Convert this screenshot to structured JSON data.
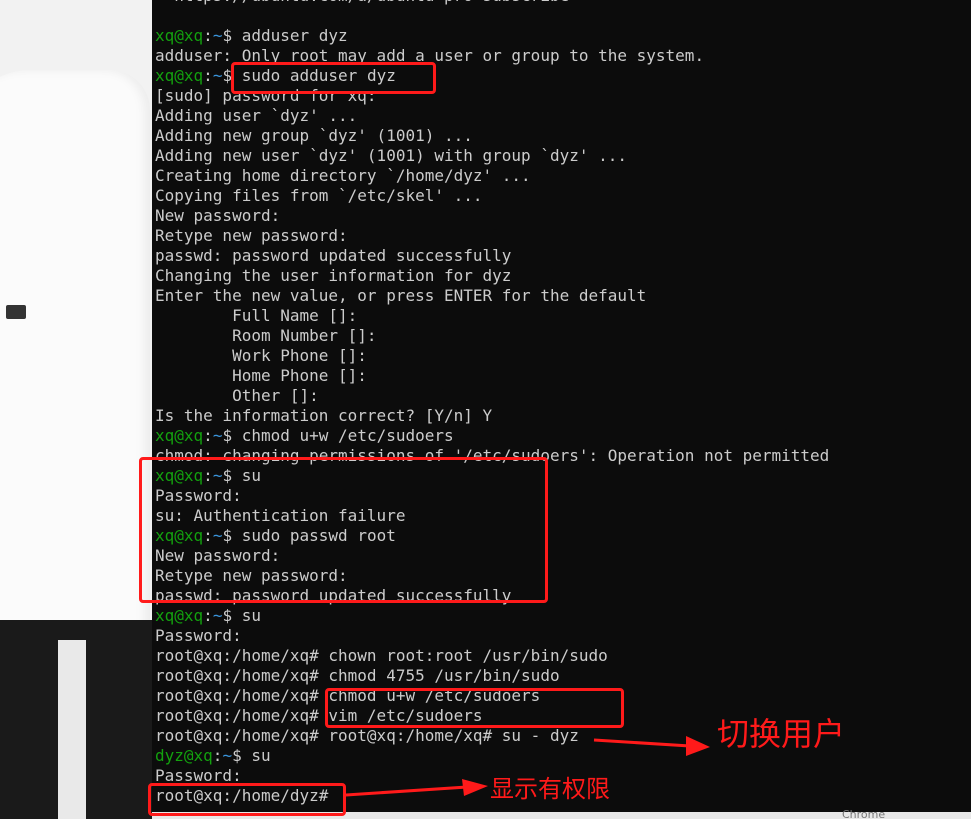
{
  "terminal": {
    "lines": [
      {
        "segments": [
          {
            "t": "  https://ubuntu.com/a/ubuntu-pro-subscribe",
            "c": "out"
          }
        ]
      },
      {
        "segments": []
      },
      {
        "segments": [
          {
            "t": "xq@xq",
            "c": "user"
          },
          {
            "t": ":",
            "c": "sep"
          },
          {
            "t": "~",
            "c": "path"
          },
          {
            "t": "$ adduser dyz",
            "c": "out"
          }
        ]
      },
      {
        "segments": [
          {
            "t": "adduser: Only root may add a user or group to the system.",
            "c": "out"
          }
        ]
      },
      {
        "segments": [
          {
            "t": "xq@xq",
            "c": "user"
          },
          {
            "t": ":",
            "c": "sep"
          },
          {
            "t": "~",
            "c": "path"
          },
          {
            "t": "$ sudo adduser dyz",
            "c": "out"
          }
        ]
      },
      {
        "segments": [
          {
            "t": "[sudo] password for xq:",
            "c": "out"
          }
        ]
      },
      {
        "segments": [
          {
            "t": "Adding user `dyz' ...",
            "c": "out"
          }
        ]
      },
      {
        "segments": [
          {
            "t": "Adding new group `dyz' (1001) ...",
            "c": "out"
          }
        ]
      },
      {
        "segments": [
          {
            "t": "Adding new user `dyz' (1001) with group `dyz' ...",
            "c": "out"
          }
        ]
      },
      {
        "segments": [
          {
            "t": "Creating home directory `/home/dyz' ...",
            "c": "out"
          }
        ]
      },
      {
        "segments": [
          {
            "t": "Copying files from `/etc/skel' ...",
            "c": "out"
          }
        ]
      },
      {
        "segments": [
          {
            "t": "New password:",
            "c": "out"
          }
        ]
      },
      {
        "segments": [
          {
            "t": "Retype new password:",
            "c": "out"
          }
        ]
      },
      {
        "segments": [
          {
            "t": "passwd: password updated successfully",
            "c": "out"
          }
        ]
      },
      {
        "segments": [
          {
            "t": "Changing the user information for dyz",
            "c": "out"
          }
        ]
      },
      {
        "segments": [
          {
            "t": "Enter the new value, or press ENTER for the default",
            "c": "out"
          }
        ]
      },
      {
        "segments": [
          {
            "t": "        Full Name []:",
            "c": "out"
          }
        ]
      },
      {
        "segments": [
          {
            "t": "        Room Number []:",
            "c": "out"
          }
        ]
      },
      {
        "segments": [
          {
            "t": "        Work Phone []:",
            "c": "out"
          }
        ]
      },
      {
        "segments": [
          {
            "t": "        Home Phone []:",
            "c": "out"
          }
        ]
      },
      {
        "segments": [
          {
            "t": "        Other []:",
            "c": "out"
          }
        ]
      },
      {
        "segments": [
          {
            "t": "Is the information correct? [Y/n] Y",
            "c": "out"
          }
        ]
      },
      {
        "segments": [
          {
            "t": "xq@xq",
            "c": "user"
          },
          {
            "t": ":",
            "c": "sep"
          },
          {
            "t": "~",
            "c": "path"
          },
          {
            "t": "$ chmod u+w /etc/sudoers",
            "c": "out"
          }
        ]
      },
      {
        "segments": [
          {
            "t": "chmod: changing permissions of '/etc/sudoers': Operation not permitted",
            "c": "out"
          }
        ]
      },
      {
        "segments": [
          {
            "t": "xq@xq",
            "c": "user"
          },
          {
            "t": ":",
            "c": "sep"
          },
          {
            "t": "~",
            "c": "path"
          },
          {
            "t": "$ su",
            "c": "out"
          }
        ]
      },
      {
        "segments": [
          {
            "t": "Password:",
            "c": "out"
          }
        ]
      },
      {
        "segments": [
          {
            "t": "su: Authentication failure",
            "c": "out"
          }
        ]
      },
      {
        "segments": [
          {
            "t": "xq@xq",
            "c": "user"
          },
          {
            "t": ":",
            "c": "sep"
          },
          {
            "t": "~",
            "c": "path"
          },
          {
            "t": "$ sudo passwd root",
            "c": "out"
          }
        ]
      },
      {
        "segments": [
          {
            "t": "New password:",
            "c": "out"
          }
        ]
      },
      {
        "segments": [
          {
            "t": "Retype new password:",
            "c": "out"
          }
        ]
      },
      {
        "segments": [
          {
            "t": "passwd: password updated successfully",
            "c": "out"
          }
        ]
      },
      {
        "segments": [
          {
            "t": "xq@xq",
            "c": "user"
          },
          {
            "t": ":",
            "c": "sep"
          },
          {
            "t": "~",
            "c": "path"
          },
          {
            "t": "$ su",
            "c": "out"
          }
        ]
      },
      {
        "segments": [
          {
            "t": "Password:",
            "c": "out"
          }
        ]
      },
      {
        "segments": [
          {
            "t": "root@xq:/home/xq# chown root:root /usr/bin/sudo",
            "c": "out"
          }
        ]
      },
      {
        "segments": [
          {
            "t": "root@xq:/home/xq# chmod 4755 /usr/bin/sudo",
            "c": "out"
          }
        ]
      },
      {
        "segments": [
          {
            "t": "root@xq:/home/xq# chmod u+w /etc/sudoers",
            "c": "out"
          }
        ]
      },
      {
        "segments": [
          {
            "t": "root@xq:/home/xq# vim /etc/sudoers",
            "c": "out"
          }
        ]
      },
      {
        "segments": [
          {
            "t": "root@xq:/home/xq# root@xq:/home/xq# su - dyz",
            "c": "out"
          }
        ]
      },
      {
        "segments": [
          {
            "t": "dyz@xq",
            "c": "user"
          },
          {
            "t": ":",
            "c": "sep"
          },
          {
            "t": "~",
            "c": "path"
          },
          {
            "t": "$ su",
            "c": "out"
          }
        ]
      },
      {
        "segments": [
          {
            "t": "Password:",
            "c": "out"
          }
        ]
      },
      {
        "segments": [
          {
            "t": "root@xq:/home/dyz#",
            "c": "out"
          }
        ]
      }
    ]
  },
  "annotations": {
    "switch_user": "切换用户",
    "shows_permission": "显示有权限",
    "color": "#ff1a1a"
  },
  "corner_text": "Chrome"
}
